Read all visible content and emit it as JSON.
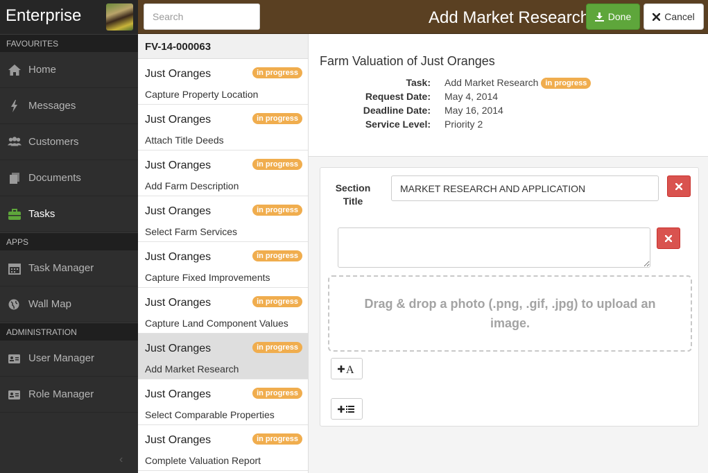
{
  "app": {
    "brand": "Enterprise"
  },
  "sidebar": {
    "sections": [
      {
        "label": "FAVOURITES",
        "items": [
          {
            "label": "Home",
            "icon": "home-icon"
          },
          {
            "label": "Messages",
            "icon": "lightning-icon"
          },
          {
            "label": "Customers",
            "icon": "users-icon"
          },
          {
            "label": "Documents",
            "icon": "documents-icon"
          },
          {
            "label": "Tasks",
            "icon": "briefcase-icon",
            "active": true
          }
        ]
      },
      {
        "label": "APPS",
        "items": [
          {
            "label": "Task Manager",
            "icon": "calendar-icon"
          },
          {
            "label": "Wall Map",
            "icon": "globe-icon"
          }
        ]
      },
      {
        "label": "ADMINISTRATION",
        "items": [
          {
            "label": "User Manager",
            "icon": "id-card-icon"
          },
          {
            "label": "Role Manager",
            "icon": "id-card-icon"
          }
        ]
      }
    ],
    "collapse_glyph": "‹"
  },
  "topbar": {
    "search_placeholder": "Search",
    "title": "Add Market Research",
    "done_label": "Done",
    "cancel_label": "Cancel"
  },
  "task_list": {
    "header": "FV-14-000063",
    "items": [
      {
        "title": "Just Oranges",
        "badge": "in progress",
        "subtitle": "Capture Property Location"
      },
      {
        "title": "Just Oranges",
        "badge": "in progress",
        "subtitle": "Attach Title Deeds"
      },
      {
        "title": "Just Oranges",
        "badge": "in progress",
        "subtitle": "Add Farm Description"
      },
      {
        "title": "Just Oranges",
        "badge": "in progress",
        "subtitle": "Select Farm Services"
      },
      {
        "title": "Just Oranges",
        "badge": "in progress",
        "subtitle": "Capture Fixed Improvements"
      },
      {
        "title": "Just Oranges",
        "badge": "in progress",
        "subtitle": "Capture Land Component Values"
      },
      {
        "title": "Just Oranges",
        "badge": "in progress",
        "subtitle": "Add Market Research",
        "selected": true
      },
      {
        "title": "Just Oranges",
        "badge": "in progress",
        "subtitle": "Select Comparable Properties"
      },
      {
        "title": "Just Oranges",
        "badge": "in progress",
        "subtitle": "Complete Valuation Report"
      }
    ]
  },
  "detail": {
    "title": "Farm Valuation of Just Oranges",
    "task_label": "Task:",
    "task_value": "Add Market Research",
    "task_badge": "in progress",
    "request_label": "Request Date:",
    "request_value": "May 4, 2014",
    "deadline_label": "Deadline Date:",
    "deadline_value": "May 16, 2014",
    "service_label": "Service Level:",
    "service_value": "Priority 2"
  },
  "editor": {
    "section_title_label": "Section Title",
    "section_title_value": "MARKET RESEARCH AND APPLICATION",
    "textarea_value": "",
    "dropzone_text": "Drag & drop a photo (.png, .gif, .jpg) to upload an image."
  },
  "colors": {
    "topbar": "#5a4022",
    "done": "#5ea63b",
    "danger": "#d9534f",
    "badge": "#f0ad4e",
    "sidebar": "#2e2e2e"
  }
}
